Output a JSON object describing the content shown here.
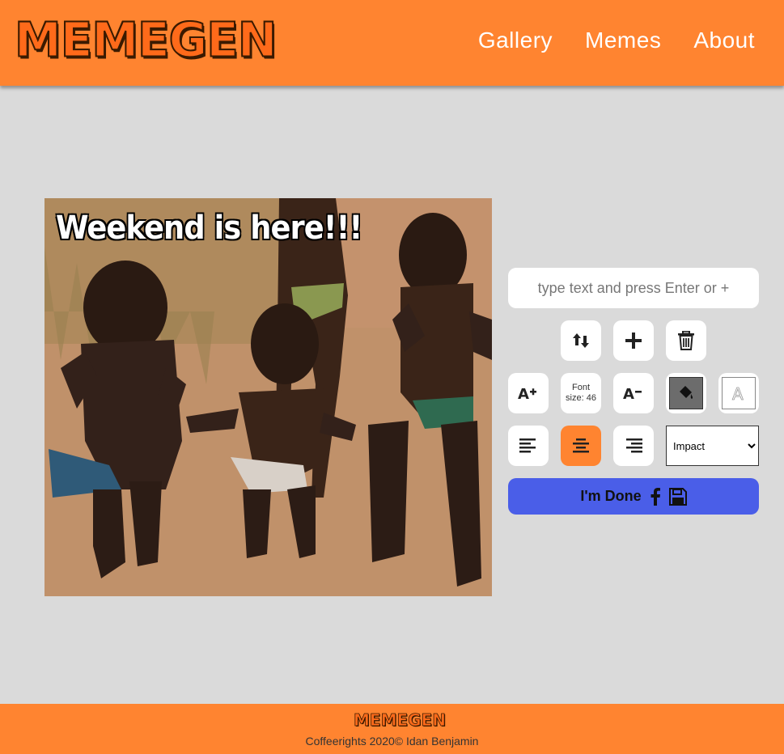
{
  "header": {
    "logo": "MEMEGEN",
    "nav": [
      "Gallery",
      "Memes",
      "About"
    ]
  },
  "canvas": {
    "meme_text": "Weekend is here!!!",
    "image_desc": "Three small kids dancing on a dirt road"
  },
  "editor": {
    "text_input_placeholder": "type text and press Enter or +",
    "font_size_label": "Font size: 46",
    "font_select_value": "Impact",
    "done_label": "I'm Done",
    "accent_color": "#ff8430",
    "done_color": "#4a5ee8",
    "icons": [
      "swap-vertical-icon",
      "plus-icon",
      "trash-icon",
      "increase-font-icon",
      "decrease-font-icon",
      "paint-bucket-icon",
      "text-outline-icon",
      "align-left-icon",
      "align-center-icon",
      "align-right-icon",
      "facebook-icon",
      "save-icon"
    ]
  },
  "footer": {
    "logo": "MEMEGEN",
    "copyright": "Coffeerights 2020© Idan Benjamin"
  }
}
